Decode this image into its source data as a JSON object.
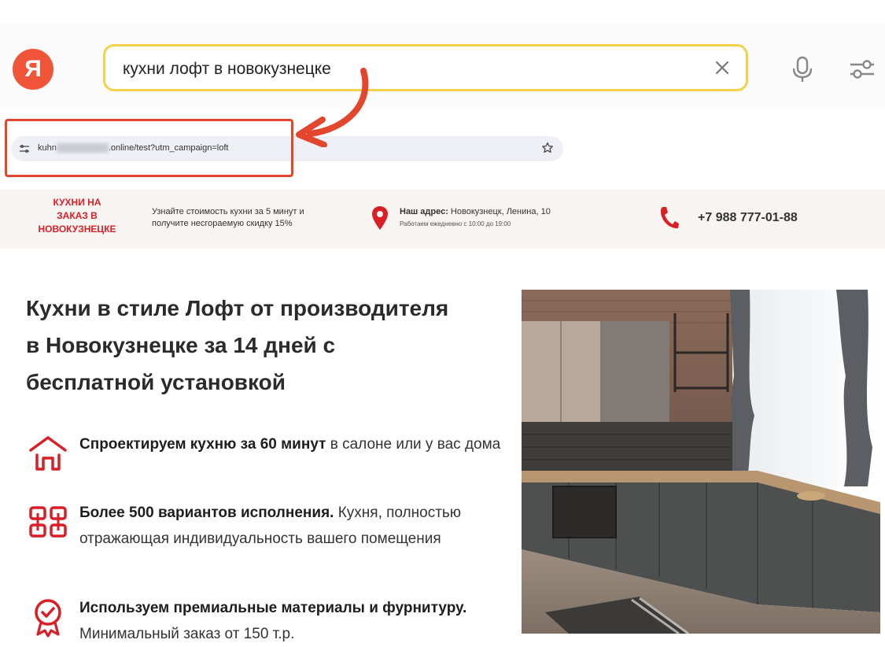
{
  "search": {
    "logo": "Я",
    "query": "кухни лофт в новокузнецке"
  },
  "browser": {
    "url_prefix": "kuhn",
    "url_suffix": ".online/test?utm_campaign=loft"
  },
  "site_header": {
    "logo_line1": "КУХНИ НА",
    "logo_line2": "ЗАКАЗ В",
    "logo_line3": "НОВОКУЗНЕЦКЕ",
    "promo_line1": "Узнайте стоимость кухни за 5 минут и",
    "promo_line2": "получите несгораемую скидку 15%",
    "address_label": "Наш адрес:",
    "address_value": "Новокузнецк, Ленина, 10",
    "hours": "Работаем ежедневно с 10:00 до 19:00",
    "phone": "+7 988 777-01-88"
  },
  "hero": {
    "title_line1": "Кухни в стиле Лофт от производителя",
    "title_line2": "в Новокузнецке за 14 дней с",
    "title_line3": "бесплатной установкой",
    "features": [
      {
        "bold": "Спроектируем кухню за 60 минут",
        "rest": " в салоне или у вас дома",
        "icon": "house-icon"
      },
      {
        "bold": "Более 500 вариантов исполнения.",
        "rest": " Кухня, полностью отражающая индивидуальность вашего помещения",
        "icon": "variants-icon"
      },
      {
        "bold": "Используем премиальные материалы и фурнитуру.",
        "rest": " Минимальный заказ от 150 т.р.",
        "icon": "quality-badge-icon"
      }
    ]
  },
  "colors": {
    "brand_red": "#d81f26",
    "yandex_red": "#f0553a",
    "search_border": "#f5d14a",
    "annotation": "#e2472e"
  }
}
